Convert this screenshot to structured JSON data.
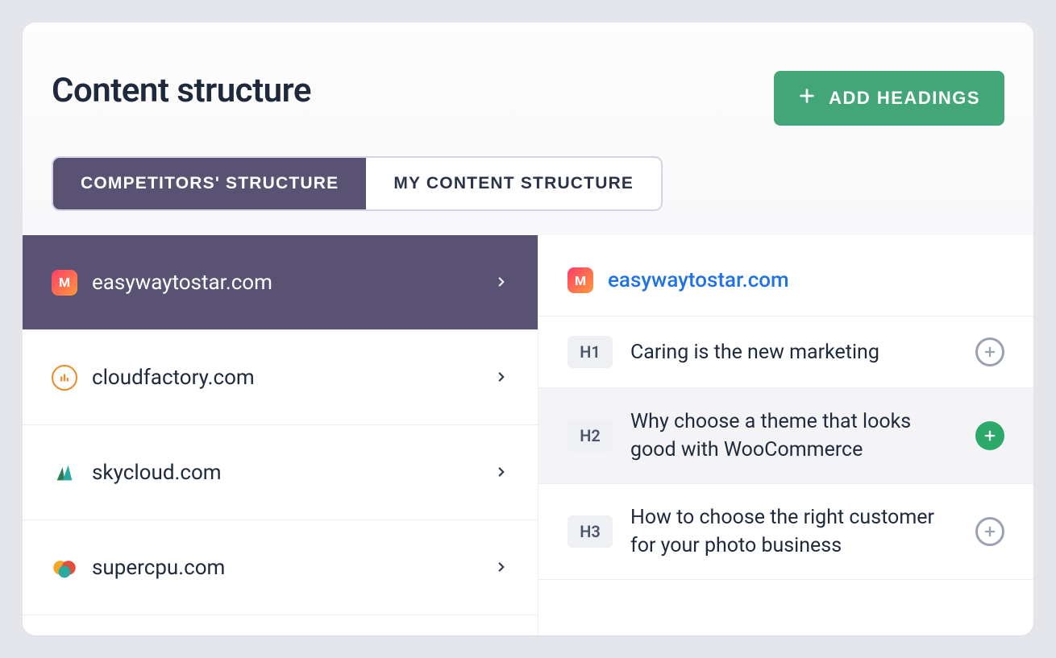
{
  "header": {
    "title": "Content structure",
    "add_button": "ADD HEADINGS"
  },
  "tabs": {
    "competitors": "COMPETITORS' STRUCTURE",
    "my_content": "MY CONTENT STRUCTURE"
  },
  "competitors": [
    {
      "domain": "easywaytostar.com",
      "favicon": "m",
      "active": true
    },
    {
      "domain": "cloudfactory.com",
      "favicon": "cf",
      "active": false
    },
    {
      "domain": "skycloud.com",
      "favicon": "sky",
      "active": false
    },
    {
      "domain": "supercpu.com",
      "favicon": "cpu",
      "active": false
    }
  ],
  "detail": {
    "domain": "easywaytostar.com",
    "headings": [
      {
        "level": "H1",
        "text": "Caring is the new marketing",
        "state": "default"
      },
      {
        "level": "H2",
        "text": "Why choose a theme that looks good with WooCommerce",
        "state": "hover"
      },
      {
        "level": "H3",
        "text": "How to choose the right customer for your photo business",
        "state": "default"
      }
    ]
  },
  "colors": {
    "accent_purple": "#5a5273",
    "accent_green": "#42a678",
    "link_blue": "#1f73e6"
  }
}
